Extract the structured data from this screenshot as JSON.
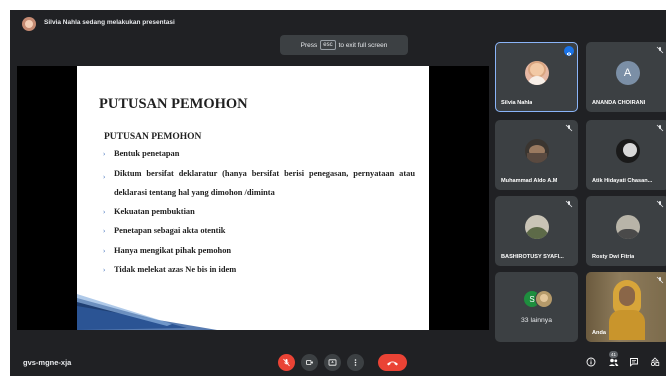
{
  "header": {
    "presenter_text": "Silvia Nahla sedang melakukan presentasi"
  },
  "fullscreen_toast": {
    "prefix": "Press",
    "key": "esc",
    "suffix": "to exit full screen"
  },
  "slide": {
    "title": "PUTUSAN PEMOHON",
    "subtitle": "PUTUSAN PEMOHON",
    "bullets": [
      "Bentuk penetapan",
      "Diktum bersifat deklaratur (hanya bersifat berisi penegasan, pernyataan atau deklarasi tentang hal yang dimohon /diminta",
      "Kekuatan pembuktian",
      "Penetapan sebagai akta otentik",
      "Hanya mengikat pihak pemohon",
      "Tidak melekat azas Ne bis in idem"
    ],
    "bullet_glyph": "›",
    "accent_color": "#5b84c4"
  },
  "participants": [
    {
      "name": "Silvia Nahla",
      "state": "speaking"
    },
    {
      "name": "ANANDA CHOIRANI",
      "initial": "A",
      "state": "muted"
    },
    {
      "name": "Muhammad Aldo A.M",
      "state": "muted"
    },
    {
      "name": "Atik Hidayati Chasan...",
      "state": "muted"
    },
    {
      "name": "BASHIROTUSY SYAFI...",
      "state": "muted"
    },
    {
      "name": "Rosty Dwi Fitria",
      "state": "muted"
    },
    {
      "others_initial": "S",
      "label": "33 lainnya"
    },
    {
      "name": "Anda",
      "state": "muted"
    }
  ],
  "bottom_bar": {
    "meeting_code": "gvs-mgne-xja",
    "people_count": "41"
  },
  "colors": {
    "background": "#202124",
    "tile": "#3c4043",
    "danger": "#ea4335",
    "active_outline": "#8ab4f8"
  }
}
